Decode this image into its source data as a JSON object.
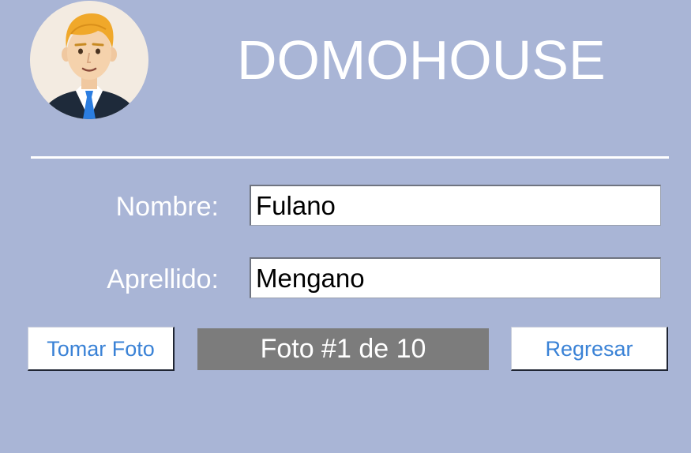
{
  "header": {
    "title": "DOMOHOUSE",
    "avatar_icon": "user-avatar-icon"
  },
  "form": {
    "nombre": {
      "label": "Nombre:",
      "value": "Fulano"
    },
    "apellido": {
      "label": "Aprellido:",
      "value": "Mengano"
    }
  },
  "actions": {
    "take_photo_label": "Tomar Foto",
    "photo_status": "Foto #1 de 10",
    "back_label": "Regresar"
  },
  "colors": {
    "background": "#a9b5d6",
    "button_text": "#3a82d6",
    "status_background": "#7c7c7c"
  }
}
